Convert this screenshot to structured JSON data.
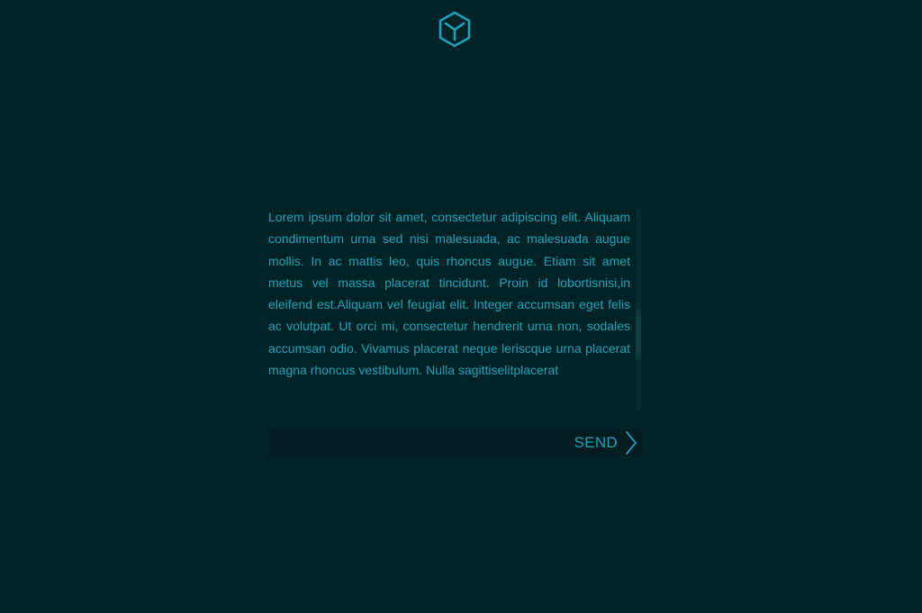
{
  "logo": {
    "icon": "hexagon-cube-logo",
    "color": "#1aa3b8"
  },
  "message": {
    "text": "Lorem ipsum dolor sit amet, consectetur adipiscing elit. Aliquam condimentum urna sed nisi malesuada, ac malesuada augue mollis. In ac mattis leo, quis rhoncus augue. Etiam sit amet metus vel massa placerat tincidunt. Proin id lobortisnisi,in eleifend est.Aliquam vel feugiat elit. Integer accumsan eget felis ac volutpat. Ut orci mi, consectetur hendrerit urna non, sodales accumsan odio. Vivamus placerat neque leriscque urna placerat magna rhoncus vestibulum. Nulla sagittiselitplacerat",
    "scroll_position": 0.66,
    "scroll_visible_fraction": 0.25
  },
  "send": {
    "label": "SEND",
    "icon": "chevron-right-icon"
  },
  "colors": {
    "background": "#012226",
    "accent": "#1aa3b8",
    "input_bg": "#021d21"
  }
}
